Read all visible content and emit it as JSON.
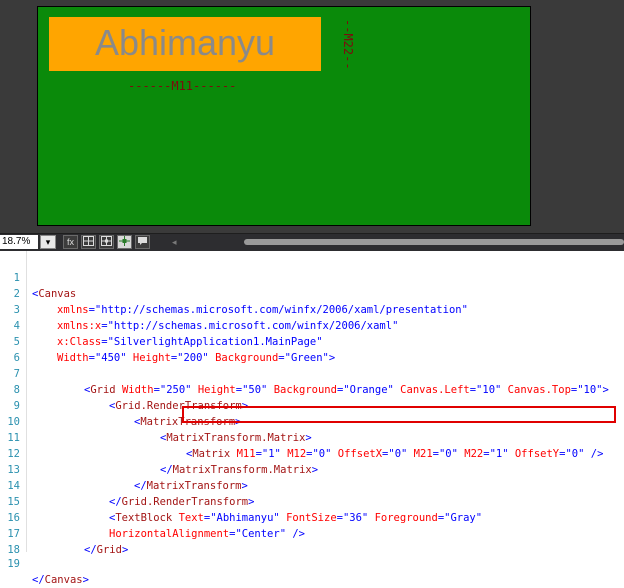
{
  "designer": {
    "textblock_text": "Abhimanyu",
    "m22_label": "--M22--",
    "m11_label": "------M11------"
  },
  "toolbar": {
    "zoom": "18.7%",
    "zoom_dropdown": "▾",
    "fx_label": "fx",
    "buttons": [
      "grid-icon",
      "snap-grid-icon",
      "snap-lines-icon",
      "annotation-icon"
    ],
    "scroll_left": "◂"
  },
  "code": {
    "line_numbers": [
      "1",
      "2",
      "3",
      "4",
      "5",
      "6",
      "7",
      "8",
      "9",
      "10",
      "11",
      "12",
      "13",
      "14",
      "15",
      "16",
      "17",
      "18",
      "19"
    ],
    "l1": {
      "p1": "<",
      "t": "Canvas"
    },
    "l2": {
      "a": "xmlns",
      "p1": "=\"",
      "v": "http://schemas.microsoft.com/winfx/2006/xaml/presentation",
      "p2": "\""
    },
    "l3": {
      "a": "xmlns:x",
      "p1": "=\"",
      "v": "http://schemas.microsoft.com/winfx/2006/xaml",
      "p2": "\""
    },
    "l4": {
      "a": "x:Class",
      "p1": "=\"",
      "v": "SilverlightApplication1.MainPage",
      "p2": "\""
    },
    "l5": {
      "a1": "Width",
      "v1": "\"450\"",
      "a2": "Height",
      "v2": "\"200\"",
      "a3": "Background",
      "v3": "\"Green\"",
      "end": ">"
    },
    "l7": {
      "t": "Grid",
      "a1": "Width",
      "v1": "\"250\"",
      "a2": "Height",
      "v2": "\"50\"",
      "a3": "Background",
      "v3": "\"Orange\"",
      "a4": "Canvas.Left",
      "v4": "\"10\"",
      "a5": "Canvas.Top",
      "v5": "\"10\""
    },
    "l8": {
      "t": "Grid.RenderTransform"
    },
    "l9": {
      "t": "MatrixTransform"
    },
    "l10": {
      "t": "MatrixTransform.Matrix"
    },
    "l11": {
      "t": "Matrix",
      "a1": "M11",
      "v1": "\"1\"",
      "a2": "M12",
      "v2": "\"0\"",
      "a3": "OffsetX",
      "v3": "\"0\"",
      "a4": "M21",
      "v4": "\"0\"",
      "a5": "M22",
      "v5": "\"1\"",
      "a6": "OffsetY",
      "v6": "\"0\""
    },
    "l12": {
      "t": "MatrixTransform.Matrix"
    },
    "l13": {
      "t": "MatrixTransform"
    },
    "l14": {
      "t": "Grid.RenderTransform"
    },
    "l15": {
      "t": "TextBlock",
      "a1": "Text",
      "v1": "\"Abhimanyu\"",
      "a2": "FontSize",
      "v2": "\"36\"",
      "a3": "Foreground",
      "v3": "\"Gray\""
    },
    "l16": {
      "a1": "HorizontalAlignment",
      "v1": "\"Center\"",
      "end": " />"
    },
    "l17": {
      "t": "Grid"
    },
    "l19": {
      "t": "Canvas"
    }
  }
}
